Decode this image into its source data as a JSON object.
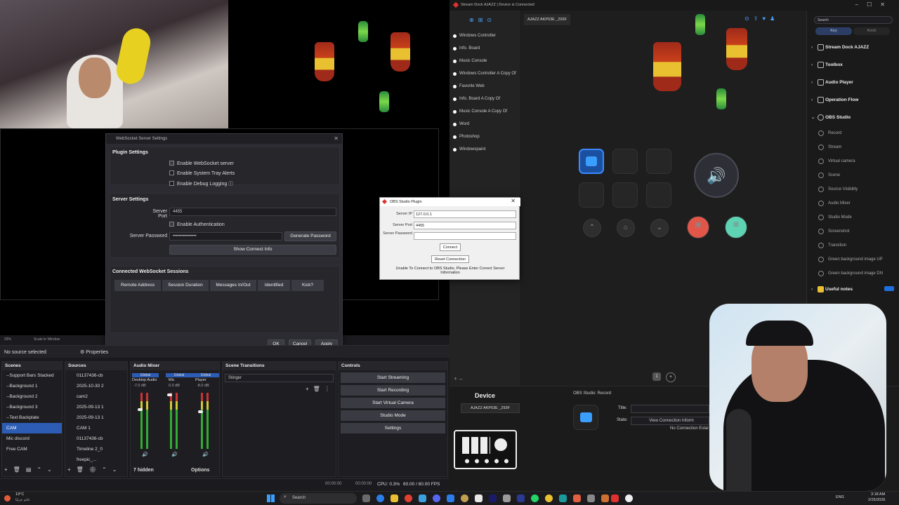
{
  "obs": {
    "status_left": "No source selected",
    "properties_label": "Properties",
    "zoom": "33%",
    "zoom_mode": "Scale to Window",
    "websocket_dialog": {
      "title": "WebSocket Server Settings",
      "plugin_settings": "Plugin Settings",
      "enable_server": "Enable WebSocket server",
      "enable_tray": "Enable System Tray Alerts",
      "enable_debug": "Enable Debug Logging",
      "server_settings": "Server Settings",
      "server_port_label": "Server Port",
      "server_port": "4455",
      "enable_auth": "Enable Authentication",
      "password_label": "Server Password",
      "password_value": "••••••••••••••••",
      "generate_password": "Generate Password",
      "show_connect_info": "Show Connect Info",
      "sessions_title": "Connected WebSocket Sessions",
      "columns": [
        "Remote Address",
        "Session Duration",
        "Messages In/Out",
        "Identified",
        "Kick?"
      ],
      "ok": "OK",
      "cancel": "Cancel",
      "apply": "Apply"
    },
    "scenes": {
      "title": "Scenes",
      "items": [
        "--Support Bars Stacked",
        "--Background 1",
        "--Background 2",
        "--Background 3",
        "--Text Backplate",
        "CAM",
        "Mic discord",
        "Free CAM"
      ],
      "selected": "CAM"
    },
    "sources": {
      "title": "Sources",
      "items": [
        "01137436-cb",
        "2025-10-30 2",
        "cam2",
        "2025-09-13 1",
        "2025-09-13 1",
        "CAM 1",
        "01137436-cb",
        "Timeline 2_0",
        "freepic_..."
      ]
    },
    "audio_mixer": {
      "title": "Audio Mixer",
      "channels": [
        {
          "name": "Desktop Audio",
          "db": "-7.0 dB",
          "tag": "Global"
        },
        {
          "name": "Mic",
          "db": "0.0 dB",
          "tag": "Global"
        },
        {
          "name": "Player",
          "db": "-8.0 dB",
          "tag": "Global"
        }
      ],
      "hidden": "7 hidden",
      "options": "Options"
    },
    "transitions": {
      "title": "Scene Transitions",
      "value": "Stinger"
    },
    "controls": {
      "title": "Controls",
      "items": [
        "Start Streaming",
        "Start Recording",
        "Start Virtual Camera",
        "Studio Mode",
        "Settings"
      ]
    },
    "statusbar": {
      "t1": "00:00:00",
      "t2": "00:00:00",
      "cpu": "CPU: 0.3%",
      "fps": "60.00 / 60.00 FPS"
    }
  },
  "streamdock": {
    "title": "Stream Dock AJAZZ  |  Device is Connected",
    "device_tab": "AJAZZ AKP03E _293F",
    "profiles": [
      "Windows Controller",
      "Info. Board",
      "Music Console",
      "Windows Controller A Copy Of",
      "Favorite Web",
      "Info. Board A Copy Of",
      "Music Console A Copy Of",
      "Word",
      "Photoshop",
      "Windowspaint"
    ],
    "search_placeholder": "Search",
    "tabs": [
      "Key",
      "Knob"
    ],
    "categories_top": [
      "Stream Dock AJAZZ",
      "Toolbox",
      "Audio Player",
      "Operation Flow",
      "OBS Studio"
    ],
    "obs_actions": [
      "Record",
      "Stream",
      "Virtual camera",
      "Scene",
      "Source Visibility",
      "Audio Mixer",
      "Studio Mode",
      "Screenshot",
      "Transition",
      "Green background image UP",
      "Green background image DN"
    ],
    "useful_notes": "Useful notes",
    "page_number": "1",
    "device_label": "Device",
    "device_select": "AJAZZ AKP03E _293F",
    "prop_title": "OBS Studio: Record",
    "title_label": "Title:",
    "state_label": "State:",
    "view_conn": "View Connection Inform",
    "no_conn": "No Connection Estal",
    "plugin_dialog": {
      "title": "OBS Studio Plugin",
      "ip_label": "Server IP",
      "ip": "127.0.0.1",
      "port_label": "Server Port",
      "port": "4455",
      "pass_label": "Server Password",
      "connect": "Connect",
      "reset": "Reset Connection",
      "message": "Unable To Connect to OBS Studio, Please Enter Correct Server Information"
    }
  },
  "taskbar": {
    "weather_temp": "19°C",
    "weather_text": "غائم جزئيًا",
    "search": "Search",
    "lang": "ENG",
    "time": "3:18 AM",
    "date": "2/25/2026"
  }
}
